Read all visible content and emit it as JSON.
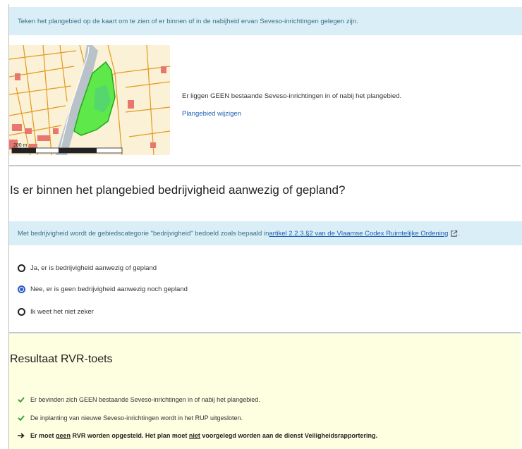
{
  "intro": {
    "text": "Teken het plangebied op de kaart om te zien of er binnen of in de nabijheid ervan Seveso-inrichtingen gelegen zijn."
  },
  "map": {
    "scale_label": "200 m",
    "colors": {
      "land": "#fbf1d6",
      "parcel_lines": "#e39a1e",
      "building": "#e8776f",
      "area_fill": "#5fe84a",
      "road": "#b9c2c9"
    }
  },
  "seveso": {
    "message": "Er liggen GEEN bestaande Seveso-inrichtingen in of nabij het plangebied.",
    "change_link": "Plangebied wijzigen"
  },
  "question": {
    "title": "Is er binnen het plangebied bedrijvigheid aanwezig of gepland?",
    "info_prefix": "Met bedrijvigheid wordt de gebiedscategorie \"bedrijvigheid\" bedoeld zoals bepaald in ",
    "info_link": "artikel 2.2.3.§2 van de Vlaamse Codex Ruimtelijke Ordening",
    "info_suffix": ".",
    "options": [
      {
        "label": "Ja, er is bedrijvigheid aanwezig of gepland",
        "checked": false
      },
      {
        "label": "Nee, er is geen bedrijvigheid aanwezig noch gepland",
        "checked": true
      },
      {
        "label": "Ik weet het niet zeker",
        "checked": false
      }
    ]
  },
  "result": {
    "title": "Resultaat RVR-toets",
    "checks": [
      "Er bevinden zich GEEN bestaande Seveso-inrichtingen in of nabij het plangebied.",
      "De inplanting van nieuwe Seveso-inrichtingen wordt in het RUP uitgesloten."
    ],
    "final": {
      "part1": "Er moet ",
      "em1": "geen",
      "part2": " RVR worden opgesteld. Het plan moet ",
      "em2": "niet",
      "part3": " voorgelegd worden aan de dienst Veiligheidsrapportering."
    },
    "colors": {
      "panel": "#fefee0",
      "check": "#3fa03a"
    }
  }
}
